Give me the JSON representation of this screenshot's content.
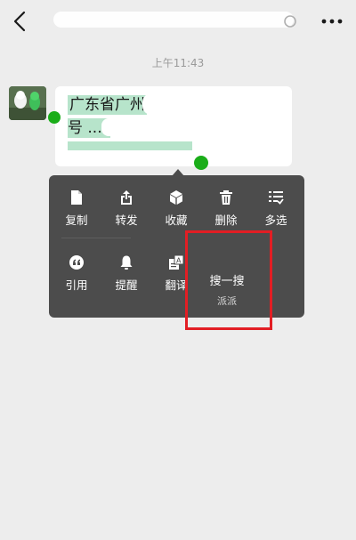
{
  "timestamp": "上午11:43",
  "message": {
    "text_visible": "广东省广州",
    "line2_visible": "号 ..."
  },
  "menu": {
    "row1": [
      {
        "key": "copy",
        "label": "复制",
        "icon": "document-icon"
      },
      {
        "key": "forward",
        "label": "转发",
        "icon": "share-icon"
      },
      {
        "key": "favorite",
        "label": "收藏",
        "icon": "cube-icon"
      },
      {
        "key": "delete",
        "label": "删除",
        "icon": "trash-icon"
      },
      {
        "key": "multiselect",
        "label": "多选",
        "icon": "checklist-icon"
      }
    ],
    "row2": [
      {
        "key": "quote",
        "label": "引用",
        "icon": "quote-icon"
      },
      {
        "key": "remind",
        "label": "提醒",
        "icon": "bell-icon"
      },
      {
        "key": "translate",
        "label": "翻译",
        "icon": "translate-icon"
      }
    ],
    "search": {
      "label": "搜一搜",
      "sub": "派派"
    }
  },
  "colors": {
    "background": "#ededed",
    "menu": "#4c4c4c",
    "selection": "#b7e4cb",
    "handle": "#1aad19",
    "highlight_box": "#e21e24"
  }
}
